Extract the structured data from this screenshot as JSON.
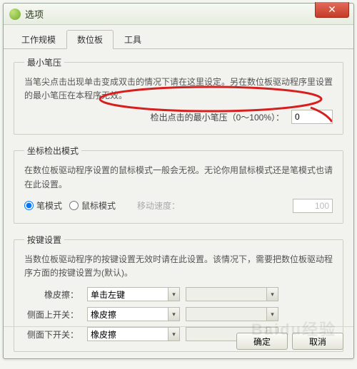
{
  "window": {
    "title": "选项"
  },
  "tabs": {
    "t0": "工作规模",
    "t1": "数位板",
    "t2": "工具"
  },
  "section1": {
    "legend": "最小笔压",
    "desc": "当笔尖点击出现单击变成双击的情况下请在这里设定。另在数位板驱动程序里设置的最小笔压在本程序无效。",
    "label": "检出点击的最小笔压（0～100%）：",
    "value": "0"
  },
  "section2": {
    "legend": "坐标检出模式",
    "desc": "在数位板驱动程序设置的鼠标模式一般会无视。无论你用鼠标模式还是笔模式也请在此设置。",
    "radio_pen": "笔模式",
    "radio_mouse": "鼠标模式",
    "speed_label": "移动速度：",
    "speed_value": "100"
  },
  "section3": {
    "legend": "按键设置",
    "desc": "当数位板驱动程序的按键设置无效时请在此设置。该情况下，需要把数位板驱动程序方面的按键设置为(默认)。",
    "row1_label": "橡皮擦：",
    "row1_val": "单击左键",
    "row2_label": "侧面上开关：",
    "row2_val": "橡皮擦",
    "row3_label": "侧面下开关：",
    "row3_val": "橡皮擦"
  },
  "footer": {
    "ok": "确定",
    "cancel": "取消"
  },
  "watermark": "Baidu经验"
}
